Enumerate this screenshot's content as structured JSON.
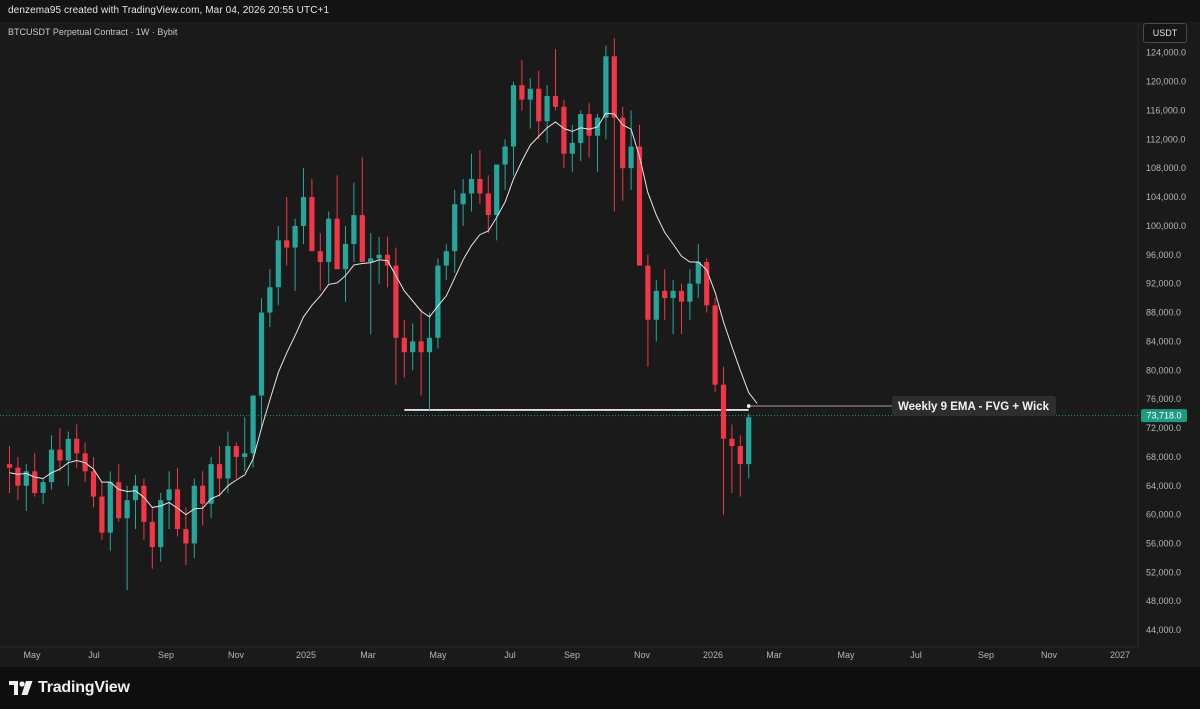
{
  "header": {
    "credit": "denzema95 created with TradingView.com, Mar 04, 2026 20:55 UTC+1"
  },
  "chart": {
    "symbol": "BTCUSDT Perpetual Contract · 1W · Bybit",
    "currency": "USDT",
    "current_price_label": "73,718.0",
    "annotation": "Weekly 9 EMA - FVG + Wick"
  },
  "footer": {
    "logo_text": "TradingView"
  },
  "colors": {
    "bull": "#26a69a",
    "bear": "#f23645",
    "ema": "#e6e6e6",
    "price_tag": "#1e9a83",
    "background": "#1a1a1a"
  },
  "chart_data": {
    "type": "candlestick",
    "interval": "1W",
    "y_axis_ticks": [
      "124,000.0",
      "120,000.0",
      "116,000.0",
      "112,000.0",
      "108,000.0",
      "104,000.0",
      "100,000.0",
      "96,000.0",
      "92,000.0",
      "88,000.0",
      "84,000.0",
      "80,000.0",
      "76,000.0",
      "72,000.0",
      "68,000.0",
      "64,000.0",
      "60,000.0",
      "56,000.0",
      "52,000.0",
      "48,000.0",
      "44,000.0"
    ],
    "ylim": [
      40000,
      128000
    ],
    "y_scale": "linear",
    "x_axis_ticks": [
      "May",
      "Jul",
      "Sep",
      "Nov",
      "2025",
      "Mar",
      "May",
      "Jul",
      "Sep",
      "Nov",
      "2026",
      "Mar",
      "May",
      "Jul",
      "Sep",
      "Nov",
      "2027"
    ],
    "current_price": 73718,
    "horizontal_line_level": 74500,
    "ema_period": 9,
    "grid": false,
    "series": [
      {
        "name": "BTCUSDT",
        "values": [
          [
            67000,
            69500,
            63000,
            66500
          ],
          [
            66500,
            68000,
            62000,
            64000
          ],
          [
            64000,
            67000,
            60500,
            66000
          ],
          [
            66000,
            68500,
            62500,
            63000
          ],
          [
            63000,
            65000,
            61500,
            64500
          ],
          [
            64500,
            71000,
            63500,
            69000
          ],
          [
            69000,
            72000,
            66000,
            67500
          ],
          [
            67500,
            71500,
            64000,
            70500
          ],
          [
            70500,
            72500,
            66500,
            68500
          ],
          [
            68500,
            70000,
            64500,
            66000
          ],
          [
            66000,
            68000,
            61000,
            62500
          ],
          [
            62500,
            64500,
            56500,
            57500
          ],
          [
            57500,
            66000,
            55000,
            64500
          ],
          [
            64500,
            67000,
            59000,
            59500
          ],
          [
            59500,
            64000,
            49500,
            62000
          ],
          [
            62000,
            65500,
            58000,
            64000
          ],
          [
            64000,
            65000,
            56500,
            59000
          ],
          [
            59000,
            61000,
            52500,
            55500
          ],
          [
            55500,
            63000,
            53500,
            62000
          ],
          [
            62000,
            66000,
            58000,
            63500
          ],
          [
            63500,
            66500,
            57000,
            58000
          ],
          [
            58000,
            61000,
            53000,
            56000
          ],
          [
            56000,
            65000,
            54000,
            64000
          ],
          [
            64000,
            66000,
            58500,
            61500
          ],
          [
            61500,
            68000,
            59500,
            67000
          ],
          [
            67000,
            69500,
            62500,
            65000
          ],
          [
            65000,
            71500,
            63000,
            69500
          ],
          [
            69500,
            70000,
            65000,
            68000
          ],
          [
            68000,
            73500,
            66000,
            68500
          ],
          [
            68500,
            75000,
            66500,
            76500
          ],
          [
            76500,
            90000,
            72000,
            88000
          ],
          [
            88000,
            94000,
            86000,
            91500
          ],
          [
            91500,
            100000,
            89000,
            98000
          ],
          [
            98000,
            104000,
            94500,
            97000
          ],
          [
            97000,
            101000,
            91000,
            100000
          ],
          [
            100000,
            108000,
            97500,
            104000
          ],
          [
            104000,
            106500,
            97000,
            96500
          ],
          [
            96500,
            99000,
            91000,
            95000
          ],
          [
            95000,
            102000,
            92000,
            101000
          ],
          [
            101000,
            107000,
            95000,
            94000
          ],
          [
            94000,
            100000,
            89500,
            97500
          ],
          [
            97500,
            106000,
            95000,
            101500
          ],
          [
            101500,
            109500,
            98000,
            95000
          ],
          [
            95000,
            99000,
            85000,
            95500
          ],
          [
            95500,
            98500,
            92000,
            96000
          ],
          [
            96000,
            98500,
            91500,
            94500
          ],
          [
            94500,
            97000,
            78000,
            84500
          ],
          [
            84500,
            87000,
            79000,
            82500
          ],
          [
            82500,
            86500,
            80000,
            84000
          ],
          [
            84000,
            88500,
            76500,
            82500
          ],
          [
            82500,
            88000,
            74500,
            84500
          ],
          [
            84500,
            95500,
            83000,
            94500
          ],
          [
            94500,
            97500,
            92500,
            96500
          ],
          [
            96500,
            105000,
            93500,
            103000
          ],
          [
            103000,
            106500,
            100000,
            104500
          ],
          [
            104500,
            110000,
            102000,
            106500
          ],
          [
            106500,
            110500,
            103000,
            104500
          ],
          [
            104500,
            107000,
            99000,
            101500
          ],
          [
            101500,
            108000,
            98000,
            108500
          ],
          [
            108500,
            112000,
            105000,
            111000
          ],
          [
            111000,
            120000,
            107000,
            119500
          ],
          [
            119500,
            123000,
            116000,
            117500
          ],
          [
            117500,
            120500,
            113500,
            119000
          ],
          [
            119000,
            121500,
            112000,
            114500
          ],
          [
            114500,
            119500,
            111500,
            118000
          ],
          [
            118000,
            124500,
            116000,
            116500
          ],
          [
            116500,
            117500,
            108000,
            110000
          ],
          [
            110000,
            114000,
            107500,
            111500
          ],
          [
            111500,
            116000,
            109000,
            115500
          ],
          [
            115500,
            117000,
            109500,
            112500
          ],
          [
            112500,
            115500,
            107500,
            115000
          ],
          [
            115000,
            125000,
            112000,
            123500
          ],
          [
            123500,
            126000,
            102000,
            115000
          ],
          [
            115000,
            116500,
            103500,
            108000
          ],
          [
            108000,
            116000,
            105000,
            111000
          ],
          [
            111000,
            114000,
            98000,
            94500
          ],
          [
            94500,
            96000,
            80500,
            87000
          ],
          [
            87000,
            92500,
            84000,
            91000
          ],
          [
            91000,
            94000,
            87000,
            90000
          ],
          [
            90000,
            92500,
            85000,
            91000
          ],
          [
            91000,
            92000,
            85000,
            89500
          ],
          [
            89500,
            94000,
            87000,
            92000
          ],
          [
            92000,
            97500,
            90000,
            95000
          ],
          [
            95000,
            95500,
            88000,
            89000
          ],
          [
            89000,
            90000,
            77000,
            78000
          ],
          [
            78000,
            80500,
            60000,
            70500
          ],
          [
            70500,
            72500,
            63000,
            69500
          ],
          [
            69500,
            71000,
            62500,
            67000
          ],
          [
            67000,
            74000,
            65000,
            73500
          ]
        ]
      },
      {
        "name": "EMA 9",
        "values": [
          65800,
          65600,
          65700,
          65200,
          65000,
          65800,
          66300,
          67200,
          67500,
          67200,
          66300,
          64500,
          64500,
          63500,
          63200,
          63300,
          62400,
          61000,
          61200,
          61700,
          60900,
          60000,
          60800,
          60900,
          62200,
          62700,
          64000,
          64800,
          65500,
          67700,
          72000,
          75900,
          79700,
          82400,
          84800,
          87400,
          89000,
          90300,
          91900,
          92100,
          93100,
          94600,
          94800,
          94900,
          95300,
          95200,
          93100,
          91000,
          89600,
          88200,
          87400,
          88900,
          90300,
          92800,
          95300,
          97300,
          98800,
          99300,
          101200,
          103300,
          106500,
          109000,
          111200,
          112400,
          113600,
          114400,
          113500,
          113100,
          113600,
          113400,
          113700,
          115600,
          115500,
          114000,
          113400,
          109600,
          104600,
          101500,
          99100,
          97500,
          95800,
          95000,
          95000,
          93900,
          90800,
          86700,
          83300,
          80000,
          76900,
          75400
        ]
      }
    ]
  }
}
